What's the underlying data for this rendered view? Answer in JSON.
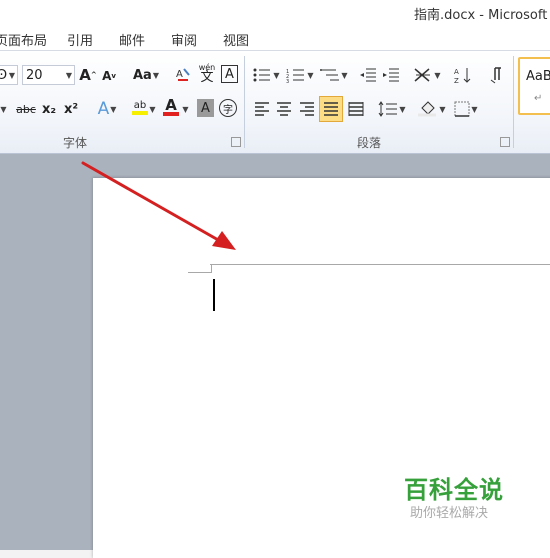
{
  "window": {
    "title": "指南.docx - Microsoft W"
  },
  "tabs": [
    {
      "label": "页面布局"
    },
    {
      "label": "引用"
    },
    {
      "label": "邮件"
    },
    {
      "label": "审阅"
    },
    {
      "label": "视图"
    }
  ],
  "font_group": {
    "label": "字体",
    "font_name_partial": "Ͽ",
    "font_size": "20",
    "grow_font": "A",
    "shrink_font": "A",
    "change_case": "Aa",
    "phonetic_guide": "wén",
    "phonetic_char": "文",
    "char_border": "A",
    "strikethrough": "abc",
    "subscript": "x₂",
    "superscript": "x²",
    "text_effects": "A",
    "highlight": "ab",
    "font_color": "A",
    "char_shading": "A",
    "enclose_char": "字"
  },
  "paragraph_group": {
    "label": "段落"
  },
  "styles": {
    "preview": "AaB",
    "pilcrow": "↵"
  },
  "watermark": {
    "title": "百科全说",
    "subtitle": "助你轻松解决"
  },
  "colors": {
    "accent_orange": "#f3c04f",
    "arrow_red": "#d42020",
    "watermark_green": "#36a03b"
  }
}
